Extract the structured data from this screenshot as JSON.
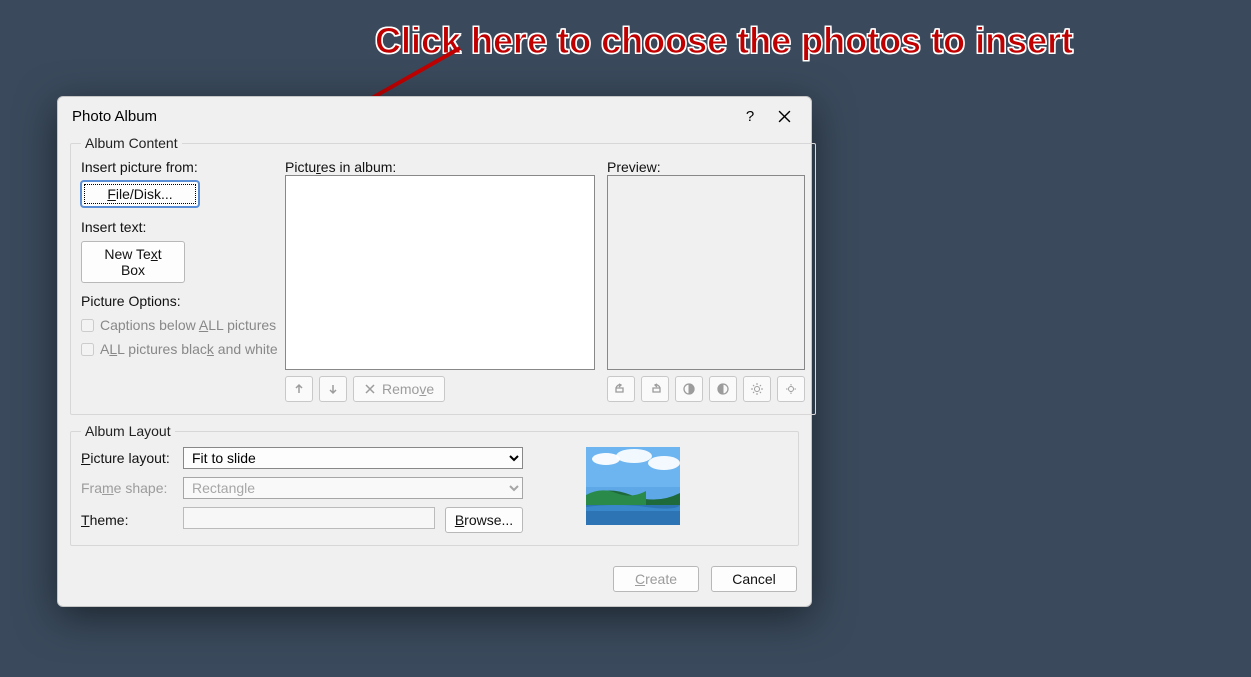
{
  "annotation": {
    "text": "Click here to choose the photos to insert"
  },
  "dialog": {
    "title": "Photo Album",
    "albumContent": {
      "legend": "Album Content",
      "insertPictureFromLabel": "Insert picture from:",
      "fileDisk": "File/Disk...",
      "insertTextLabel": "Insert text:",
      "newTextBox": "New Text Box",
      "pictureOptionsLabel": "Picture Options:",
      "captionsBelowAll": "Captions below ALL pictures",
      "allBlackWhite": "ALL pictures black and white",
      "picturesInAlbumLabel": "Pictures in album:",
      "previewLabel": "Preview:",
      "removeLabel": "Remove"
    },
    "albumLayout": {
      "legend": "Album Layout",
      "pictureLayoutLabel": "Picture layout:",
      "pictureLayoutValue": "Fit to slide",
      "frameShapeLabel": "Frame shape:",
      "frameShapeValue": "Rectangle",
      "themeLabel": "Theme:",
      "themeValue": "",
      "browseLabel": "Browse..."
    },
    "footer": {
      "create": "Create",
      "cancel": "Cancel"
    }
  }
}
